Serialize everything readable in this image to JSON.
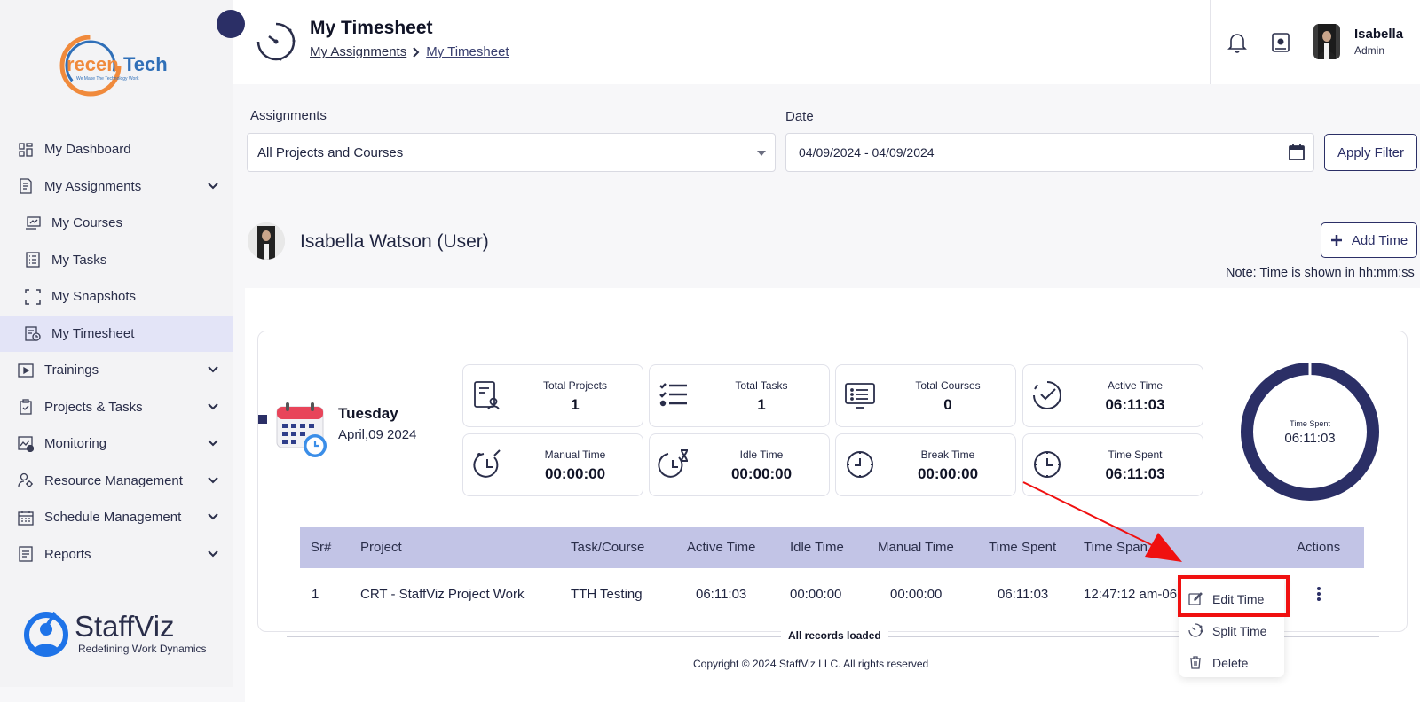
{
  "brand": {
    "name": "recenTech",
    "tagline": "We Make The Technology Work"
  },
  "sidebar": {
    "items": [
      {
        "label": "My Dashboard",
        "icon": "dashboard-icon",
        "expandable": false,
        "sub": false,
        "active": false
      },
      {
        "label": "My Assignments",
        "icon": "assignments-icon",
        "expandable": true,
        "sub": false,
        "active": false
      },
      {
        "label": "My Courses",
        "icon": "courses-icon",
        "expandable": false,
        "sub": true,
        "active": false
      },
      {
        "label": "My Tasks",
        "icon": "tasks-icon",
        "expandable": false,
        "sub": true,
        "active": false
      },
      {
        "label": "My Snapshots",
        "icon": "snapshots-icon",
        "expandable": false,
        "sub": true,
        "active": false
      },
      {
        "label": "My Timesheet",
        "icon": "timesheet-icon",
        "expandable": false,
        "sub": true,
        "active": true
      },
      {
        "label": "Trainings",
        "icon": "play-icon",
        "expandable": true,
        "sub": false,
        "active": false
      },
      {
        "label": "Projects & Tasks",
        "icon": "clipboard-icon",
        "expandable": true,
        "sub": false,
        "active": false
      },
      {
        "label": "Monitoring",
        "icon": "monitoring-icon",
        "expandable": true,
        "sub": false,
        "active": false
      },
      {
        "label": "Resource Management",
        "icon": "users-gear-icon",
        "expandable": true,
        "sub": false,
        "active": false
      },
      {
        "label": "Schedule Management",
        "icon": "schedule-icon",
        "expandable": true,
        "sub": false,
        "active": false
      },
      {
        "label": "Reports",
        "icon": "reports-icon",
        "expandable": true,
        "sub": false,
        "active": false
      }
    ],
    "footer_brand": "StaffViz",
    "footer_tagline": "Redefining Work Dynamics"
  },
  "header": {
    "title": "My Timesheet",
    "breadcrumb": [
      "My Assignments",
      "My Timesheet"
    ],
    "user_name": "Isabella",
    "user_role": "Admin"
  },
  "filters": {
    "assignments_label": "Assignments",
    "assignments_value": "All Projects and Courses",
    "date_label": "Date",
    "date_value": "04/09/2024 - 04/09/2024",
    "apply_label": "Apply Filter"
  },
  "user_section": {
    "heading": "Isabella Watson (User)",
    "add_time_label": "Add Time",
    "note": "Note: Time is shown in hh:mm:ss"
  },
  "day": {
    "name": "Tuesday",
    "date": "April,09 2024"
  },
  "stats": [
    {
      "label": "Total Projects",
      "value": "1",
      "icon": "projects-icon"
    },
    {
      "label": "Total Tasks",
      "value": "1",
      "icon": "task-list-icon"
    },
    {
      "label": "Total Courses",
      "value": "0",
      "icon": "monitor-list-icon"
    },
    {
      "label": "Active Time",
      "value": "06:11:03",
      "icon": "clock-check-icon"
    },
    {
      "label": "Manual Time",
      "value": "00:00:00",
      "icon": "clock-pen-icon"
    },
    {
      "label": "Idle Time",
      "value": "00:00:00",
      "icon": "hourglass-clock-icon"
    },
    {
      "label": "Break Time",
      "value": "00:00:00",
      "icon": "clock-icon"
    },
    {
      "label": "Time Spent",
      "value": "06:11:03",
      "icon": "clock-icon"
    }
  ],
  "donut": {
    "label": "Time Spent",
    "value": "06:11:03",
    "fraction": 1.0,
    "color": "#2b2f66"
  },
  "table": {
    "headers": [
      "Sr#",
      "Project",
      "Task/Course",
      "Active Time",
      "Idle Time",
      "Manual Time",
      "Time Spent",
      "Time Span",
      "Actions"
    ],
    "rows": [
      [
        "1",
        "CRT - StaffViz Project Work",
        "TTH Testing",
        "06:11:03",
        "00:00:00",
        "00:00:00",
        "06:11:03",
        "12:47:12 am-06"
      ]
    ],
    "footer": "All records loaded"
  },
  "context_menu": {
    "items": [
      {
        "label": "Edit Time",
        "icon": "edit-icon"
      },
      {
        "label": "Split Time",
        "icon": "split-clock-icon"
      },
      {
        "label": "Delete",
        "icon": "trash-icon"
      }
    ]
  },
  "copyright": "Copyright © 2024 StaffViz LLC. All rights reserved",
  "colors": {
    "accent": "#2b2f66",
    "table_header": "#c2c4e6",
    "active_nav": "#e3e4f7",
    "highlight": "#f01010"
  }
}
